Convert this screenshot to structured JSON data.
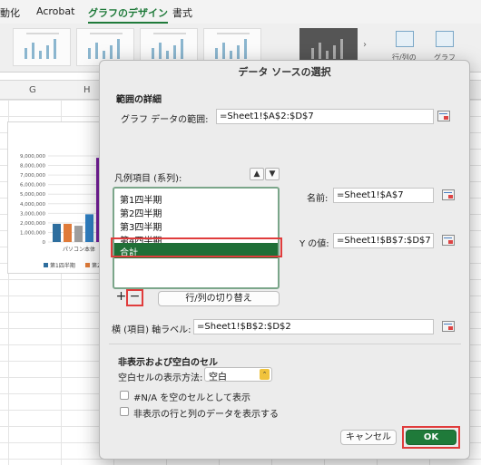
{
  "ribbon": {
    "tabs": [
      "動化",
      "Acrobat",
      "グラフのデザイン",
      "書式"
    ],
    "active_tab": "グラフのデザイン",
    "more_arrow": "›",
    "switch_row_col_label": "行/列の",
    "chart_label": "グラフ"
  },
  "sheet": {
    "columns": [
      "G",
      "H"
    ]
  },
  "chart_data": {
    "type": "bar",
    "categories": [
      "パソコン本体"
    ],
    "y_ticks": [
      "9,000,000",
      "8,000,000",
      "7,000,000",
      "6,000,000",
      "5,000,000",
      "4,000,000",
      "3,000,000",
      "2,000,000",
      "1,000,000",
      "0"
    ],
    "ylim": [
      0,
      9000000
    ],
    "series": [
      {
        "name": "第1四半期",
        "values": [
          1900000
        ],
        "color": "#2e6e9e"
      },
      {
        "name": "第2四半期",
        "values": [
          1900000
        ],
        "color": "#e07b39"
      },
      {
        "name": "",
        "values": [
          1700000
        ],
        "color": "#9e9e9e"
      },
      {
        "name": "",
        "values": [
          2900000
        ],
        "color": "#2f7ec1"
      },
      {
        "name": "",
        "values": [
          8800000
        ],
        "color": "#7a1fa2"
      }
    ],
    "legend": [
      "第1四半期",
      "第2"
    ],
    "legend_position": "bottom"
  },
  "dialog": {
    "title": "データ ソースの選択",
    "range_section": "範囲の詳細",
    "range_label": "グラフ データの範囲:",
    "range_value": "=Sheet1!$A$2:$D$7",
    "series_label": "凡例項目 (系列):",
    "up_arrow": "▲",
    "down_arrow": "▼",
    "series": [
      "第1四半期",
      "第2四半期",
      "第3四半期",
      "第4四半期",
      "合計"
    ],
    "selected_index": 4,
    "name_label": "名前:",
    "name_value": "=Sheet1!$A$7",
    "y_label": "Y の値:",
    "y_value": "=Sheet1!$B$7:$D$7",
    "add_symbol": "+",
    "remove_symbol": "−",
    "switch_button": "行/列の切り替え",
    "axis_label": "横 (項目) 軸ラベル:",
    "axis_value": "=Sheet1!$B$2:$D$2",
    "hidden_section": "非表示および空白のセル",
    "blank_label": "空白セルの表示方法:",
    "blank_value": "空白",
    "blank_chevron": "⌃",
    "na_checkbox": "#N/A を空のセルとして表示",
    "hidden_checkbox": "非表示の行と列のデータを表示する",
    "cancel_button": "キャンセル",
    "ok_button": "OK"
  }
}
